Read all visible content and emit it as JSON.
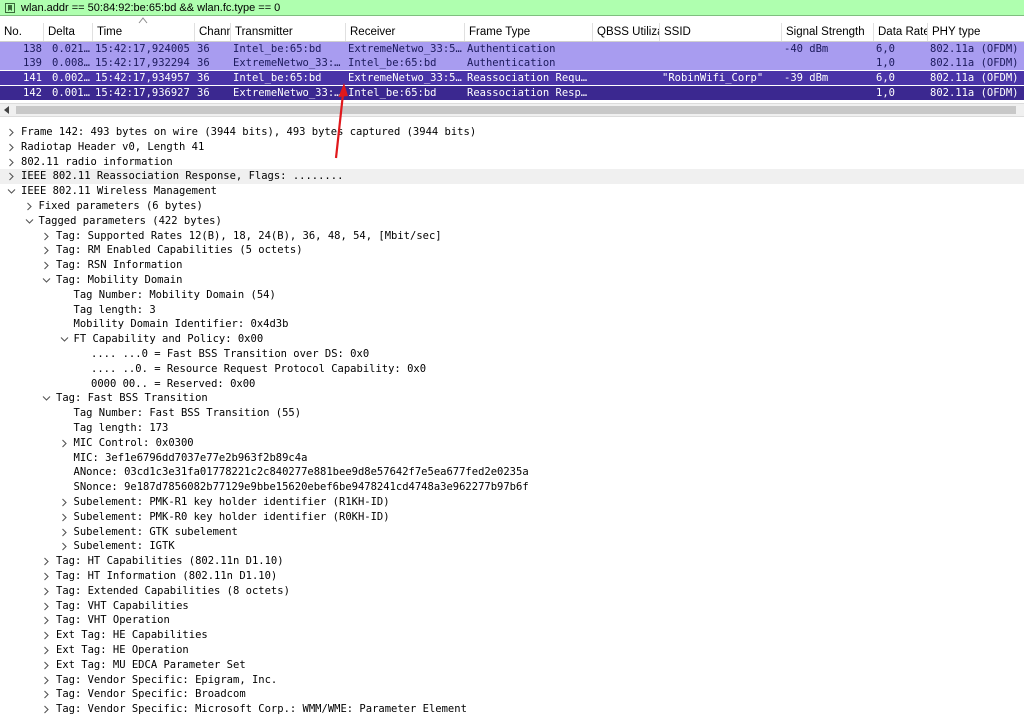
{
  "filter": {
    "text": "wlan.addr == 50:84:92:be:65:bd && wlan.fc.type == 0",
    "bg_color": "#afffaf"
  },
  "columns": [
    "No.",
    "Delta",
    "Time",
    "Channel",
    "Transmitter",
    "Receiver",
    "Frame Type",
    "QBSS Utiliza",
    "SSID",
    "Signal Strength",
    "Data Rate",
    "PHY type"
  ],
  "packets": [
    {
      "no": "138",
      "delta": "0.021…",
      "time": "15:42:17,924005",
      "channel": "36",
      "transmitter": "Intel_be:65:bd",
      "receiver": "ExtremeNetwo_33:5…",
      "frame_type": "Authentication",
      "qbss": "",
      "ssid": "",
      "signal": "-40 dBm",
      "rate": "6,0",
      "phy": "802.11a (OFDM)"
    },
    {
      "no": "139",
      "delta": "0.008…",
      "time": "15:42:17,932294",
      "channel": "36",
      "transmitter": "ExtremeNetwo_33:…",
      "receiver": "Intel_be:65:bd",
      "frame_type": "Authentication",
      "qbss": "",
      "ssid": "",
      "signal": "",
      "rate": "1,0",
      "phy": "802.11a (OFDM)"
    },
    {
      "no": "141",
      "delta": "0.002…",
      "time": "15:42:17,934957",
      "channel": "36",
      "transmitter": "Intel_be:65:bd",
      "receiver": "ExtremeNetwo_33:5…",
      "frame_type": "Reassociation Requ…",
      "qbss": "",
      "ssid": "\"RobinWifi_Corp\"",
      "signal": "-39 dBm",
      "rate": "6,0",
      "phy": "802.11a (OFDM)"
    },
    {
      "no": "142",
      "delta": "0.001…",
      "time": "15:42:17,936927",
      "channel": "36",
      "transmitter": "ExtremeNetwo_33:…",
      "receiver": "Intel_be:65:bd",
      "frame_type": "Reassociation Resp…",
      "qbss": "",
      "ssid": "",
      "signal": "",
      "rate": "1,0",
      "phy": "802.11a (OFDM)"
    }
  ],
  "tree": [
    {
      "text": "Frame 142: 493 bytes on wire (3944 bits), 493 bytes captured (3944 bits)",
      "state": "collapsed",
      "depth": 0
    },
    {
      "text": "Radiotap Header v0, Length 41",
      "state": "collapsed",
      "depth": 0
    },
    {
      "text": "802.11 radio information",
      "state": "collapsed",
      "depth": 0
    },
    {
      "text": "IEEE 802.11 Reassociation Response, Flags: ........",
      "state": "collapsed",
      "depth": 0
    },
    {
      "text": "IEEE 802.11 Wireless Management",
      "state": "expanded",
      "depth": 0
    },
    {
      "text": "Fixed parameters (6 bytes)",
      "state": "collapsed",
      "depth": 1
    },
    {
      "text": "Tagged parameters (422 bytes)",
      "state": "expanded",
      "depth": 1
    },
    {
      "text": "Tag: Supported Rates 12(B), 18, 24(B), 36, 48, 54, [Mbit/sec]",
      "state": "collapsed",
      "depth": 2
    },
    {
      "text": "Tag: RM Enabled Capabilities (5 octets)",
      "state": "collapsed",
      "depth": 2
    },
    {
      "text": "Tag: RSN Information",
      "state": "collapsed",
      "depth": 2
    },
    {
      "text": "Tag: Mobility Domain",
      "state": "expanded",
      "depth": 2
    },
    {
      "text": "Tag Number: Mobility Domain (54)",
      "state": "none",
      "depth": 3
    },
    {
      "text": "Tag length: 3",
      "state": "none",
      "depth": 3
    },
    {
      "text": "Mobility Domain Identifier: 0x4d3b",
      "state": "none",
      "depth": 3
    },
    {
      "text": "FT Capability and Policy: 0x00",
      "state": "expanded",
      "depth": 3
    },
    {
      "text": ".... ...0 = Fast BSS Transition over DS: 0x0",
      "state": "none",
      "depth": 4
    },
    {
      "text": ".... ..0. = Resource Request Protocol Capability: 0x0",
      "state": "none",
      "depth": 4
    },
    {
      "text": "0000 00.. = Reserved: 0x00",
      "state": "none",
      "depth": 4
    },
    {
      "text": "Tag: Fast BSS Transition",
      "state": "expanded",
      "depth": 2
    },
    {
      "text": "Tag Number: Fast BSS Transition (55)",
      "state": "none",
      "depth": 3
    },
    {
      "text": "Tag length: 173",
      "state": "none",
      "depth": 3
    },
    {
      "text": "MIC Control: 0x0300",
      "state": "collapsed",
      "depth": 3
    },
    {
      "text": "MIC: 3ef1e6796dd7037e77e2b963f2b89c4a",
      "state": "none",
      "depth": 3
    },
    {
      "text": "ANonce: 03cd1c3e31fa01778221c2c840277e881bee9d8e57642f7e5ea677fed2e0235a",
      "state": "none",
      "depth": 3
    },
    {
      "text": "SNonce: 9e187d7856082b77129e9bbe15620ebef6be9478241cd4748a3e962277b97b6f",
      "state": "none",
      "depth": 3
    },
    {
      "text": "Subelement: PMK-R1 key holder identifier (R1KH-ID)",
      "state": "collapsed",
      "depth": 3
    },
    {
      "text": "Subelement: PMK-R0 key holder identifier (R0KH-ID)",
      "state": "collapsed",
      "depth": 3
    },
    {
      "text": "Subelement: GTK subelement",
      "state": "collapsed",
      "depth": 3
    },
    {
      "text": "Subelement: IGTK",
      "state": "collapsed",
      "depth": 3
    },
    {
      "text": "Tag: HT Capabilities (802.11n D1.10)",
      "state": "collapsed",
      "depth": 2
    },
    {
      "text": "Tag: HT Information (802.11n D1.10)",
      "state": "collapsed",
      "depth": 2
    },
    {
      "text": "Tag: Extended Capabilities (8 octets)",
      "state": "collapsed",
      "depth": 2
    },
    {
      "text": "Tag: VHT Capabilities",
      "state": "collapsed",
      "depth": 2
    },
    {
      "text": "Tag: VHT Operation",
      "state": "collapsed",
      "depth": 2
    },
    {
      "text": "Ext Tag: HE Capabilities",
      "state": "collapsed",
      "depth": 2
    },
    {
      "text": "Ext Tag: HE Operation",
      "state": "collapsed",
      "depth": 2
    },
    {
      "text": "Ext Tag: MU EDCA Parameter Set",
      "state": "collapsed",
      "depth": 2
    },
    {
      "text": "Tag: Vendor Specific: Epigram, Inc.",
      "state": "collapsed",
      "depth": 2
    },
    {
      "text": "Tag: Vendor Specific: Broadcom",
      "state": "collapsed",
      "depth": 2
    },
    {
      "text": "Tag: Vendor Specific: Microsoft Corp.: WMM/WME: Parameter Element",
      "state": "collapsed",
      "depth": 2
    }
  ],
  "colors": {
    "row_light": "#a89cf0",
    "row_selected": "#4a34a8",
    "annotation_arrow": "#e0181c"
  }
}
